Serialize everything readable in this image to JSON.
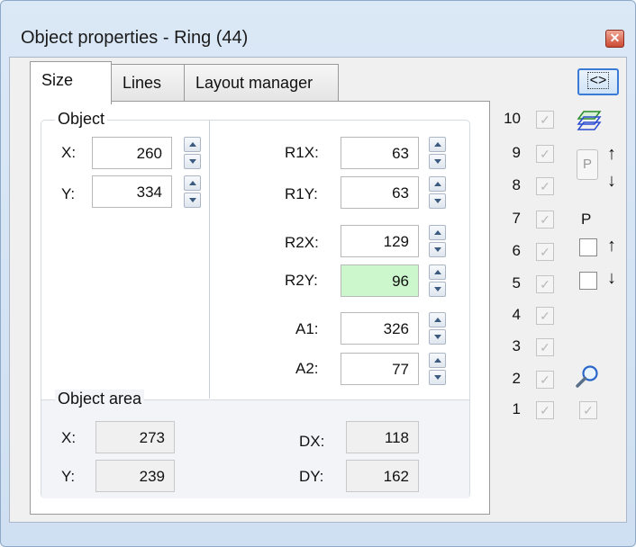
{
  "window": {
    "title": "Object properties - Ring (44)",
    "close_glyph": "✕"
  },
  "tabs": [
    {
      "label": "Size",
      "active": true
    },
    {
      "label": "Lines",
      "active": false
    },
    {
      "label": "Layout manager",
      "active": false
    }
  ],
  "object_group": {
    "legend": "Object",
    "x_label": "X:",
    "x_value": "260",
    "y_label": "Y:",
    "y_value": "334"
  },
  "radius_fields": {
    "r1x_label": "R1X:",
    "r1x_value": "63",
    "r1y_label": "R1Y:",
    "r1y_value": "63",
    "r2x_label": "R2X:",
    "r2x_value": "129",
    "r2y_label": "R2Y:",
    "r2y_value": "96",
    "a1_label": "A1:",
    "a1_value": "326",
    "a2_label": "A2:",
    "a2_value": "77"
  },
  "object_area": {
    "legend": "Object area",
    "x_label": "X:",
    "x_value": "273",
    "y_label": "Y:",
    "y_value": "239",
    "dx_label": "DX:",
    "dx_value": "118",
    "dy_label": "DY:",
    "dy_value": "162"
  },
  "right_panel": {
    "swap_label": "<>",
    "layers": [
      "10",
      "9",
      "8",
      "7",
      "6",
      "5",
      "4",
      "3",
      "2",
      "1"
    ],
    "p_button_label": "P",
    "p_label": "P",
    "up_arrow": "↑",
    "down_arrow": "↓",
    "icons": [
      "layers-icon",
      "magnifier-icon"
    ]
  },
  "colors": {
    "highlight_field": "#ccf7cc",
    "window_frame": "#cfe0f2",
    "accent": "#3a7bd5"
  }
}
